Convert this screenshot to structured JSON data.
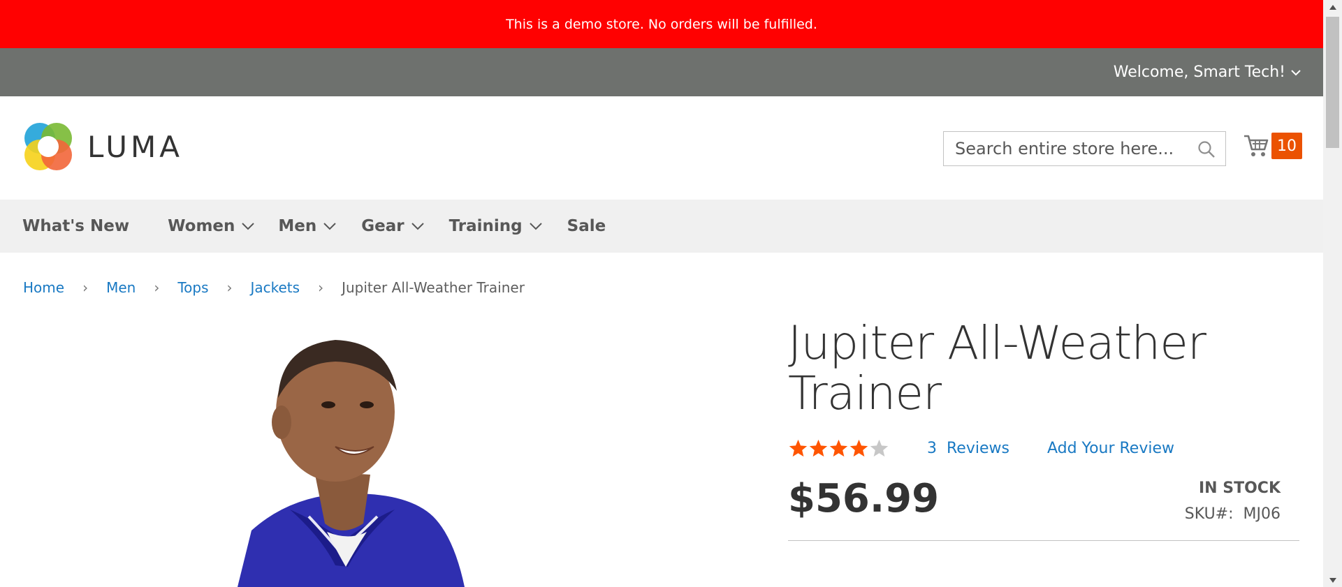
{
  "demo_notice": "This is a demo store. No orders will be fulfilled.",
  "header_panel": {
    "welcome": "Welcome, Smart Tech!"
  },
  "logo": {
    "text": "LUMA"
  },
  "search": {
    "placeholder": "Search entire store here..."
  },
  "cart": {
    "count": "10"
  },
  "nav": {
    "items": [
      {
        "label": "What's New",
        "has_dropdown": false
      },
      {
        "label": "Women",
        "has_dropdown": true
      },
      {
        "label": "Men",
        "has_dropdown": true
      },
      {
        "label": "Gear",
        "has_dropdown": true
      },
      {
        "label": "Training",
        "has_dropdown": true
      },
      {
        "label": "Sale",
        "has_dropdown": false
      }
    ]
  },
  "breadcrumb": {
    "links": [
      "Home",
      "Men",
      "Tops",
      "Jackets"
    ],
    "current": "Jupiter All-Weather Trainer"
  },
  "product": {
    "title": "Jupiter All-Weather Trainer",
    "rating_stars": 4,
    "rating_max": 5,
    "reviews_count": "3",
    "reviews_label": "Reviews",
    "add_review": "Add Your Review",
    "price": "$56.99",
    "stock": "IN STOCK",
    "sku_label": "SKU#:",
    "sku": "MJ06"
  },
  "colors": {
    "demo_bar": "#ff0101",
    "panel_header": "#6e716e",
    "link": "#1979c3",
    "cart_badge": "#eb5202",
    "star_filled": "#ff5501",
    "star_empty": "#c7c7c7"
  }
}
